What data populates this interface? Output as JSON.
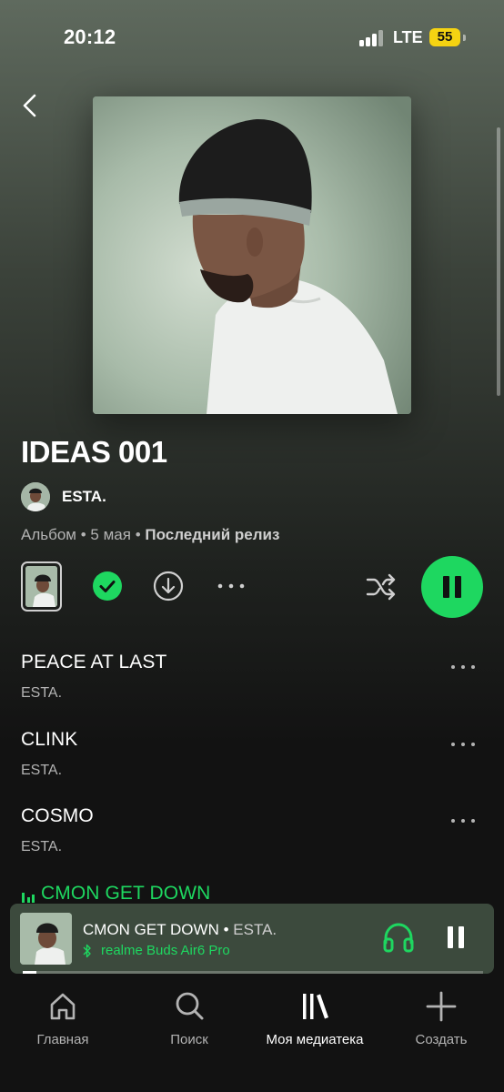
{
  "status_bar": {
    "time": "20:12",
    "network": "LTE",
    "battery": "55",
    "battery_color": "#f5d312"
  },
  "album": {
    "title": "IDEAS 001",
    "artist": "ESTA.",
    "type": "Альбом",
    "date": "5 мая",
    "badge": "Последний релиз"
  },
  "actions": {
    "saved": true,
    "icons": [
      "back-chevron-icon",
      "saved-check-icon",
      "download-icon",
      "more-icon",
      "shuffle-icon",
      "pause-icon"
    ]
  },
  "tracks": [
    {
      "title": "PEACE AT LAST",
      "artist": "ESTA.",
      "playing": false
    },
    {
      "title": "CLINK",
      "artist": "ESTA.",
      "playing": false
    },
    {
      "title": "COSMO",
      "artist": "ESTA.",
      "playing": false
    },
    {
      "title": "CMON GET DOWN",
      "artist": "ESTA.",
      "playing": true
    }
  ],
  "now_playing": {
    "title": "CMON GET DOWN",
    "separator": " • ",
    "artist": "ESTA.",
    "device": "realme Buds Air6 Pro",
    "progress": 0.03
  },
  "nav": {
    "items": [
      {
        "label": "Главная",
        "icon": "home-icon",
        "active": false
      },
      {
        "label": "Поиск",
        "icon": "search-icon",
        "active": false
      },
      {
        "label": "Моя медиатека",
        "icon": "library-icon",
        "active": true
      },
      {
        "label": "Создать",
        "icon": "plus-icon",
        "active": false
      }
    ]
  },
  "colors": {
    "accent": "#1ed760",
    "background": "#121212",
    "header_tint": "#5f6a5e",
    "mini_player": "#3c4a3d"
  }
}
